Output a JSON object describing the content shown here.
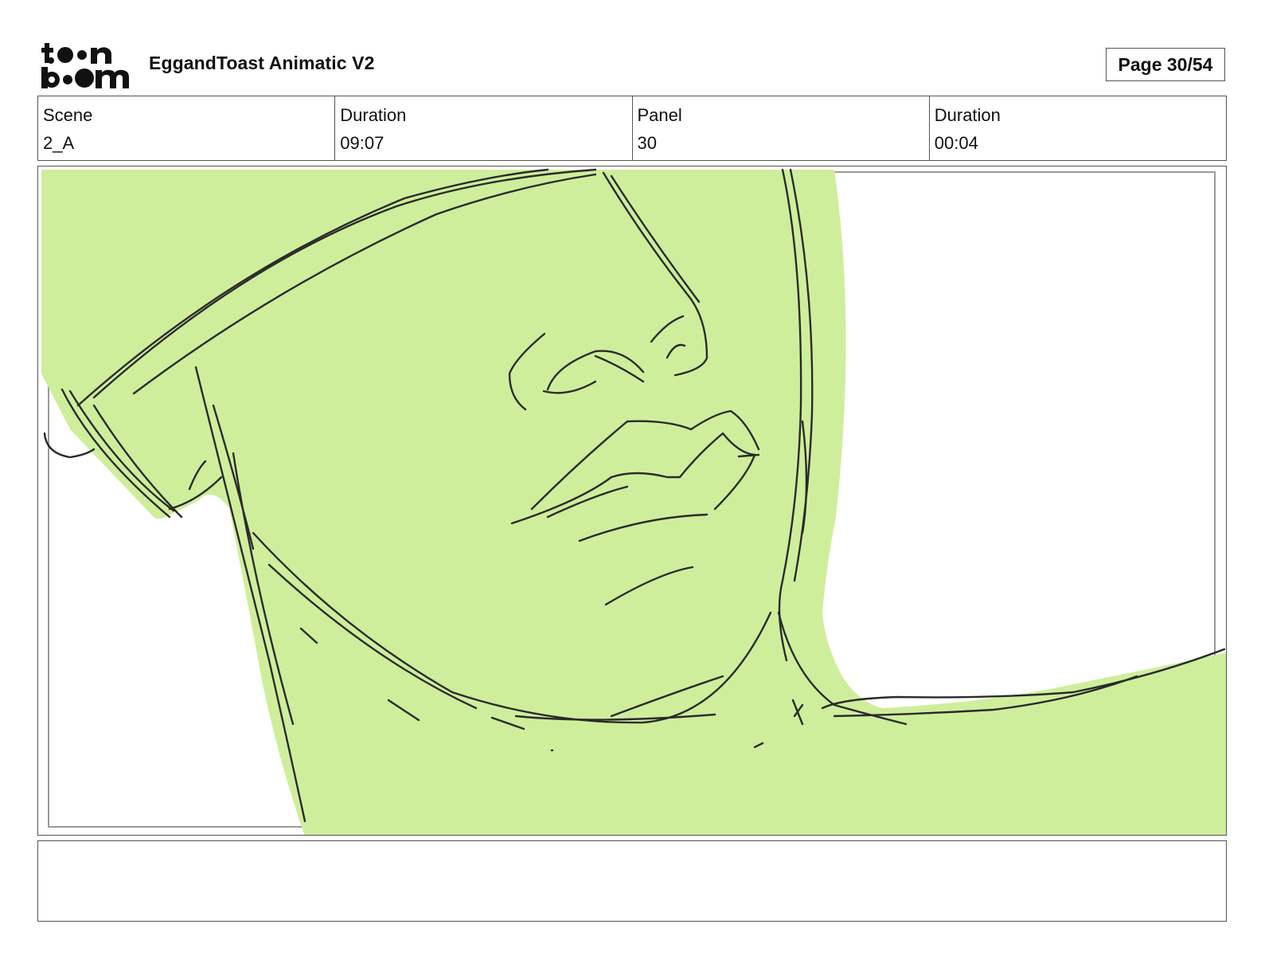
{
  "header": {
    "logo_alt": "toon boom",
    "title": "EggandToast Animatic V2",
    "page_label": "Page 30/54"
  },
  "info": {
    "scene_label": "Scene",
    "scene_value": "2_A",
    "scene_duration_label": "Duration",
    "scene_duration_value": "09:07",
    "panel_label": "Panel",
    "panel_value": "30",
    "panel_duration_label": "Duration",
    "panel_duration_value": "00:04"
  },
  "panel": {
    "fill_color": "#cfee9b",
    "line_color": "#2a2a2a"
  },
  "notes": {
    "text": ""
  }
}
